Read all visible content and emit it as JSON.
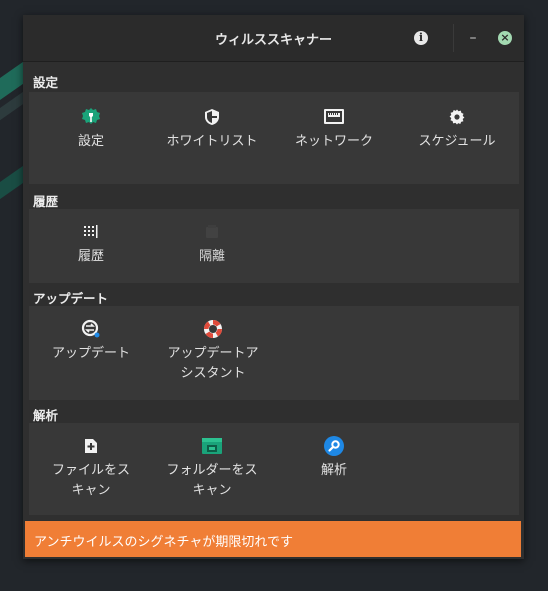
{
  "window": {
    "title": "ウィルススキャナー"
  },
  "titlebar": {
    "info_icon": "info-icon",
    "min_glyph": "–",
    "close_icon": "close-icon",
    "info_glyph": "i",
    "close_glyph": "×"
  },
  "sections": {
    "settings": {
      "label": "設定",
      "items": [
        {
          "label": "設定",
          "icon": "wrench-gear-icon"
        },
        {
          "label": "ホワイトリスト",
          "icon": "shield-icon"
        },
        {
          "label": "ネットワーク",
          "icon": "network-icon"
        },
        {
          "label": "スケジュール",
          "icon": "gear-icon"
        }
      ]
    },
    "history": {
      "label": "履歴",
      "items": [
        {
          "label": "履歴",
          "icon": "history-list-icon"
        },
        {
          "label": "隔離",
          "icon": "quarantine-icon"
        }
      ]
    },
    "update": {
      "label": "アップデート",
      "items": [
        {
          "label": "アップデート",
          "icon": "update-icon"
        },
        {
          "label": "アップデートアシスタント",
          "label_line1": "アップデートア",
          "label_line2": "シスタント",
          "icon": "lifebuoy-icon"
        }
      ]
    },
    "analysis": {
      "label": "解析",
      "items": [
        {
          "label_line1": "ファイルをス",
          "label_line2": "キャン",
          "icon": "file-add-icon"
        },
        {
          "label_line1": "フォルダーをス",
          "label_line2": "キャン",
          "icon": "folder-icon"
        },
        {
          "label": "解析",
          "icon": "magnifier-icon"
        }
      ]
    }
  },
  "status": {
    "message": "アンチウイルスのシグネチャが期限切れです",
    "color": "#f07e36"
  },
  "colors": {
    "accent_green": "#1aa37a",
    "accent_blue": "#1e88e5",
    "lifebuoy_red": "#e04a3a"
  }
}
